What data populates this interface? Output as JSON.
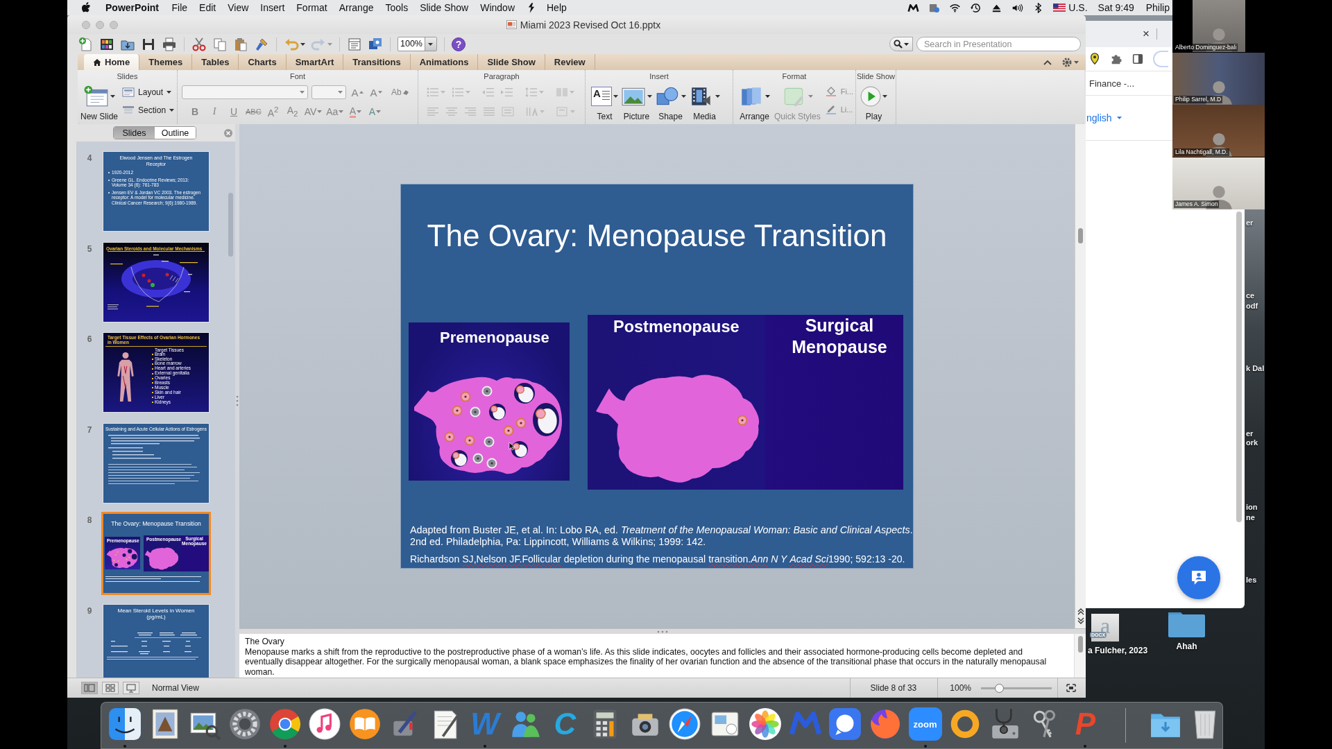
{
  "menubar": {
    "app_name": "PowerPoint",
    "menus": [
      {
        "kind": "text",
        "label": "File"
      },
      {
        "kind": "text",
        "label": "Edit"
      },
      {
        "kind": "text",
        "label": "View"
      },
      {
        "kind": "text",
        "label": "Insert"
      },
      {
        "kind": "text",
        "label": "Format"
      },
      {
        "kind": "text",
        "label": "Arrange"
      },
      {
        "kind": "text",
        "label": "Tools"
      },
      {
        "kind": "text",
        "label": "Slide Show"
      },
      {
        "kind": "text",
        "label": "Window"
      },
      {
        "kind": "script"
      },
      {
        "kind": "text",
        "label": "Help"
      }
    ],
    "input_source": "U.S.",
    "clock": "Sat 9:49",
    "user": "Philip"
  },
  "window": {
    "title": "Miami 2023 Revised Oct 16.pptx",
    "zoom": "100%",
    "help": "?",
    "search_placeholder": "Search in Presentation"
  },
  "tabs": [
    {
      "kind": "home",
      "label": "Home",
      "selected": true
    },
    {
      "kind": "plain",
      "label": "Themes",
      "selected": false
    },
    {
      "kind": "plain",
      "label": "Tables",
      "selected": false
    },
    {
      "kind": "plain",
      "label": "Charts",
      "selected": false
    },
    {
      "kind": "plain",
      "label": "SmartArt",
      "selected": false
    },
    {
      "kind": "plain",
      "label": "Transitions",
      "selected": false
    },
    {
      "kind": "plain",
      "label": "Animations",
      "selected": false
    },
    {
      "kind": "plain",
      "label": "Slide Show",
      "selected": false
    },
    {
      "kind": "plain",
      "label": "Review",
      "selected": false
    }
  ],
  "ribbon": {
    "slides": {
      "label": "Slides",
      "new_slide": "New Slide",
      "layout": "Layout",
      "section": "Section"
    },
    "font": {
      "label": "Font",
      "disabled": true,
      "grow": "A",
      "shrink": "A",
      "clear": "Ab",
      "styles": [
        {
          "kind": "bold",
          "glyph": "B"
        },
        {
          "kind": "italic",
          "glyph": "I"
        },
        {
          "kind": "underline",
          "glyph": "U"
        },
        {
          "kind": "strikethrough",
          "glyph": "ABC"
        },
        {
          "kind": "superscript",
          "glyph": "A$^{2}$"
        },
        {
          "kind": "subscript",
          "glyph": "A$_{2}$"
        },
        {
          "kind": "character-spacing",
          "glyph": "AV"
        },
        {
          "kind": "change-case",
          "glyph": "Aa"
        },
        {
          "kind": "font-color",
          "glyph": "A"
        },
        {
          "kind": "text-effects",
          "glyph": "A"
        }
      ]
    },
    "paragraph": {
      "label": "Paragraph",
      "disabled": true
    },
    "insert": {
      "label": "Insert",
      "items": [
        {
          "kind": "text-box",
          "label": "Text",
          "glyph": "A"
        },
        {
          "kind": "picture",
          "label": "Picture"
        },
        {
          "kind": "shape",
          "label": "Shape"
        },
        {
          "kind": "media",
          "label": "Media"
        }
      ]
    },
    "format": {
      "label": "Format",
      "items": [
        {
          "kind": "arrange",
          "label": "Arrange",
          "disabled": false
        },
        {
          "kind": "quick-styles",
          "label": "Quick Styles",
          "disabled": true
        },
        {
          "kind": "fill",
          "label": "Fi...",
          "disabled": true
        },
        {
          "kind": "line",
          "label": "Li...",
          "disabled": true
        }
      ]
    },
    "slide_show": {
      "label": "Slide Show",
      "play": "Play"
    }
  },
  "pane_tabs": [
    {
      "label": "Slides",
      "selected": true
    },
    {
      "label": "Outline",
      "selected": false
    }
  ],
  "thumbnails": [
    {
      "number": "4",
      "selected": false,
      "kind": "bullets",
      "title": "Elwood Jensen and The Estrogen Receptor",
      "bullets": [
        "1920-2012",
        "Greene GL. Endocrine Reviews; 2013: Volume 34 (6): 761-783",
        "Jensen EV & Jordan VC 2003. The estrogen receptor: A model for molecular medicine. Clinical Cancer Research; 9(6):1980-1989."
      ]
    },
    {
      "number": "5",
      "selected": false,
      "kind": "cell-diagram",
      "title": "Ovarian Steroids and Molecular Mechanisms"
    },
    {
      "number": "6",
      "selected": false,
      "kind": "figure-list",
      "title": "Target Tissue Effects of Ovarian Hormones in Women",
      "list_title": "Target Tissues",
      "items": [
        "Brain",
        "Skeleton",
        "Bone marrow",
        "Heart and arteries",
        "External genitalia",
        "Ovaries",
        "Breasts",
        "Muscle",
        "Skin and hair",
        "Liver",
        "Kidneys"
      ]
    },
    {
      "number": "7",
      "selected": false,
      "kind": "dense-text",
      "title": "Sustaining and Acute Cellular Actions of Estrogens"
    },
    {
      "number": "8",
      "selected": true,
      "kind": "figures",
      "title": "The Ovary: Menopause Transition",
      "captions": [
        "Premenopause",
        "Postmenopause",
        "Surgical Menopause"
      ]
    },
    {
      "number": "9",
      "selected": false,
      "kind": "table",
      "title": "Mean Steroid Levels in Women (pg/mL)"
    }
  ],
  "slide": {
    "title": "The Ovary: Menopause Transition",
    "figures": [
      {
        "kind": "many-follicles",
        "captions": [
          "Premenopause"
        ]
      },
      {
        "kind": "one-follicle-and-blank",
        "captions": [
          "Postmenopause",
          "Surgical Menopause"
        ]
      }
    ],
    "citation": "Adapted from Buster JE, et al. In: Lobo RA, ed. *Treatment of the Menopausal Woman: Basic and Clinical Aspects*. 2nd ed. Philadelphia, Pa: Lippincott, Williams & Wilkins; 1999: 142.",
    "reference": [
      {
        "text": "Richardson ",
        "misspelled": false
      },
      {
        "text": "SJ,Nelson JF.Follicular",
        "misspelled": true
      },
      {
        "text": " depletion during the menopausal ",
        "misspelled": false
      },
      {
        "text": "transition.*Ann*",
        "misspelled": true
      },
      {
        "text": " *N Y* ",
        "misspelled": false
      },
      {
        "text": "*Acad Sci*",
        "misspelled": true
      },
      {
        "text": "1990; 592:13 -20.",
        "misspelled": false
      }
    ]
  },
  "notes": {
    "title": "The Ovary",
    "body": "Menopause marks a shift from the reproductive to the postreproductive phase of a woman’s life. As this slide indicates, oocytes and follicles and their associated hormone-producing cells become depleted and eventually disappear altogether. For the surgically menopausal woman, a blank space emphasizes the finality of her ovarian function and the absence of the transitional phase that occurs in the naturally menopausal woman."
  },
  "status_bar": {
    "views": [
      {
        "kind": "normal",
        "selected": true
      },
      {
        "kind": "sorter",
        "selected": false
      },
      {
        "kind": "presenter",
        "selected": false
      }
    ],
    "view": "Normal View",
    "position": "Slide 8 of 33",
    "zoom": "100%",
    "zoom_slider": {
      "level": 0.25
    }
  },
  "browser": {
    "close": "×",
    "bookmark": "Finance -...",
    "language": "nglish"
  },
  "participants": [
    {
      "name": "Alberto Dominguez-bali"
    },
    {
      "name": "Philip Sarrel, M.D"
    },
    {
      "name": "Lila Nachtigall, M.D."
    },
    {
      "name": "James A. Simon"
    }
  ],
  "desktop_label_fragments": [
    "er",
    "ce",
    "odf",
    "k Dal",
    "er",
    "ork",
    "ion",
    "ne",
    "les"
  ],
  "desktop_icons": [
    {
      "kind": "document",
      "glyph": "a",
      "badge": "DOCX",
      "label": "a Fulcher, 2023"
    },
    {
      "kind": "folder",
      "label": "Ahah"
    }
  ],
  "dock": [
    {
      "kind": "finder",
      "running": true
    },
    {
      "kind": "stamp",
      "running": false
    },
    {
      "kind": "photo-viewer",
      "running": false
    },
    {
      "kind": "gear",
      "running": false
    },
    {
      "kind": "ring-logo",
      "running": true
    },
    {
      "kind": "music",
      "running": false
    },
    {
      "kind": "book",
      "running": false
    },
    {
      "kind": "pen",
      "running": false
    },
    {
      "kind": "paper",
      "running": false
    },
    {
      "kind": "letter",
      "glyph": "W",
      "color": "#2b7cd3",
      "running": true
    },
    {
      "kind": "people",
      "running": false
    },
    {
      "kind": "letter",
      "glyph": "C",
      "color": "#27a9e1",
      "running": false
    },
    {
      "kind": "calculator",
      "running": false
    },
    {
      "kind": "camera",
      "running": false
    },
    {
      "kind": "compass",
      "running": false
    },
    {
      "kind": "photo-card",
      "running": false
    },
    {
      "kind": "flower",
      "running": false
    },
    {
      "kind": "zigzag",
      "running": false
    },
    {
      "kind": "speech",
      "running": false
    },
    {
      "kind": "flame-globe",
      "running": false
    },
    {
      "kind": "text-tile",
      "glyph": "zoom",
      "running": true
    },
    {
      "kind": "ring",
      "running": false
    },
    {
      "kind": "stethoscope",
      "running": false
    },
    {
      "kind": "keys",
      "running": false
    },
    {
      "kind": "letter",
      "glyph": "P",
      "color": "#e8472b",
      "running": true
    },
    {
      "kind": "separator",
      "running": false
    },
    {
      "kind": "download-folder",
      "running": false
    },
    {
      "kind": "trash",
      "running": false
    }
  ]
}
